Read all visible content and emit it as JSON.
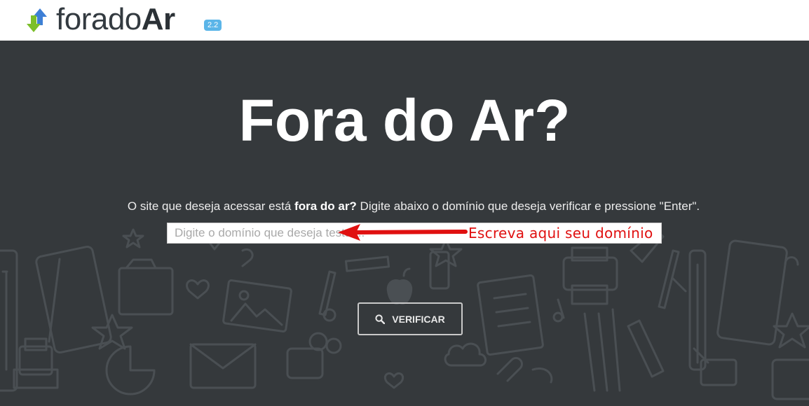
{
  "header": {
    "logo_light": "forado",
    "logo_bold": "Ar",
    "version": "2.2"
  },
  "hero": {
    "title": "Fora do Ar?",
    "description_start": "O site que deseja acessar está ",
    "description_bold": "fora do ar?",
    "description_end": " Digite abaixo o domínio que deseja verificar e pressione \"Enter\".",
    "input_placeholder": "Digite o domínio que deseja testar...",
    "input_value": "",
    "annotation_text": "Escreva aqui seu domínio",
    "annotation_color": "#e01010",
    "button_label": "VERIFICAR",
    "button_icon": "search-icon"
  },
  "colors": {
    "hero_background": "#35393c",
    "badge": "#5bb5e8",
    "logo_arrow_up": "#3d7fd6",
    "logo_arrow_down": "#7cbf2a"
  }
}
